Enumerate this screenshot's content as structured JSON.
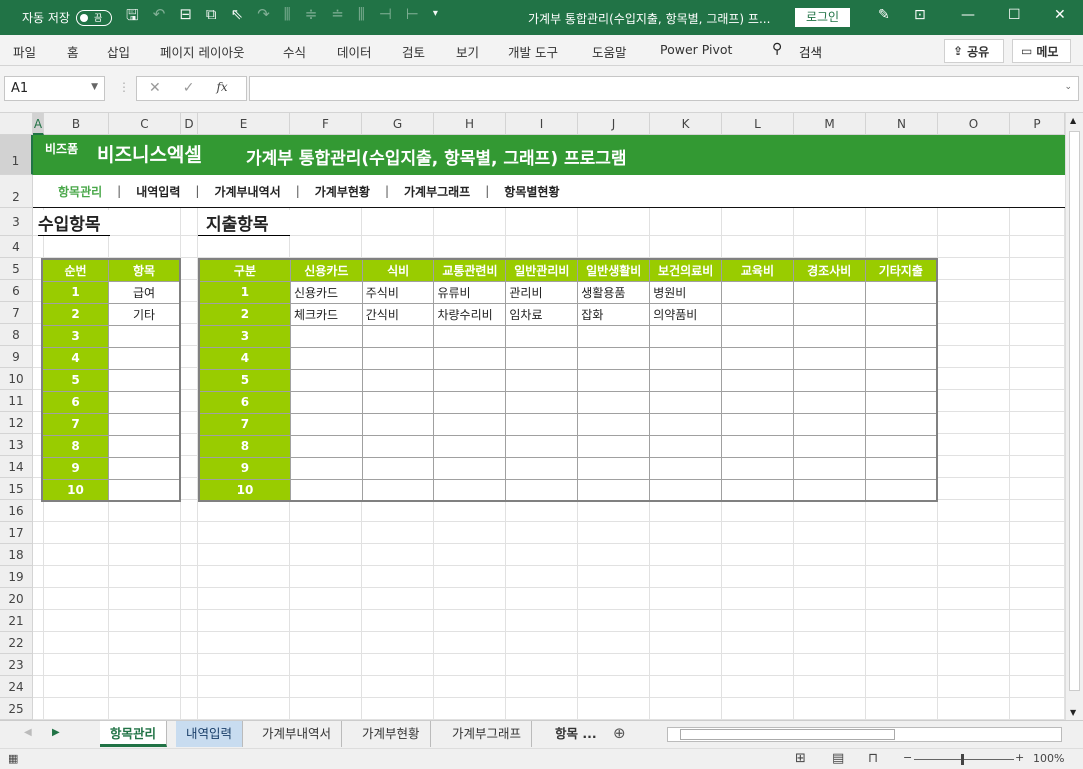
{
  "titlebar": {
    "autosave_label": "자동 저장",
    "autosave_state": "끔",
    "title": "가계부 통합관리(수입지출, 항목별, 그래프) 프...",
    "login": "로그인"
  },
  "ribbon": {
    "tabs": [
      "파일",
      "홈",
      "삽입",
      "페이지 레이아웃",
      "수식",
      "데이터",
      "검토",
      "보기",
      "개발 도구",
      "도움말",
      "Power Pivot"
    ],
    "search": "검색",
    "share": "공유",
    "comment": "메모"
  },
  "formula_bar": {
    "name_box": "A1",
    "fx": "fx",
    "value": ""
  },
  "columns": [
    "A",
    "B",
    "C",
    "D",
    "E",
    "F",
    "G",
    "H",
    "I",
    "J",
    "K",
    "L",
    "M",
    "N",
    "O",
    "P"
  ],
  "rows": [
    "1",
    "2",
    "3",
    "4",
    "5",
    "6",
    "7",
    "8",
    "9",
    "10",
    "11",
    "12",
    "13",
    "14",
    "15",
    "16",
    "17",
    "18",
    "19",
    "20",
    "21",
    "22",
    "23",
    "24",
    "25"
  ],
  "banner": {
    "brand_small": "비즈폼",
    "brand": "비즈니스엑셀",
    "title": "가계부 통합관리(수입지출, 항목별, 그래프) 프로그램"
  },
  "nav": [
    "항목관리",
    "내역입력",
    "가계부내역서",
    "가계부현황",
    "가계부그래프",
    "항목별현황"
  ],
  "income": {
    "title": "수입항목",
    "headers": [
      "순번",
      "항목"
    ],
    "rows": [
      [
        "1",
        "급여"
      ],
      [
        "2",
        "기타"
      ],
      [
        "3",
        ""
      ],
      [
        "4",
        ""
      ],
      [
        "5",
        ""
      ],
      [
        "6",
        ""
      ],
      [
        "7",
        ""
      ],
      [
        "8",
        ""
      ],
      [
        "9",
        ""
      ],
      [
        "10",
        ""
      ]
    ]
  },
  "expense": {
    "title": "지출항목",
    "headers": [
      "구분",
      "신용카드",
      "식비",
      "교통관련비",
      "일반관리비",
      "일반생활비",
      "보건의료비",
      "교육비",
      "경조사비",
      "기타지출"
    ],
    "rows": [
      [
        "1",
        "신용카드",
        "주식비",
        "유류비",
        "관리비",
        "생활용품",
        "병원비",
        "",
        "",
        ""
      ],
      [
        "2",
        "체크카드",
        "간식비",
        "차량수리비",
        "임차료",
        "잡화",
        "의약품비",
        "",
        "",
        ""
      ],
      [
        "3",
        "",
        "",
        "",
        "",
        "",
        "",
        "",
        "",
        ""
      ],
      [
        "4",
        "",
        "",
        "",
        "",
        "",
        "",
        "",
        "",
        ""
      ],
      [
        "5",
        "",
        "",
        "",
        "",
        "",
        "",
        "",
        "",
        ""
      ],
      [
        "6",
        "",
        "",
        "",
        "",
        "",
        "",
        "",
        "",
        ""
      ],
      [
        "7",
        "",
        "",
        "",
        "",
        "",
        "",
        "",
        "",
        ""
      ],
      [
        "8",
        "",
        "",
        "",
        "",
        "",
        "",
        "",
        "",
        ""
      ],
      [
        "9",
        "",
        "",
        "",
        "",
        "",
        "",
        "",
        "",
        ""
      ],
      [
        "10",
        "",
        "",
        "",
        "",
        "",
        "",
        "",
        "",
        ""
      ]
    ]
  },
  "sheet_tabs": [
    "항목관리",
    "내역입력",
    "가계부내역서",
    "가계부현황",
    "가계부그래프",
    "항목 ..."
  ],
  "status": {
    "zoom": "100%"
  },
  "colors": {
    "title_green": "#217346",
    "banner_green": "#339933",
    "header_green": "#99cc00"
  }
}
